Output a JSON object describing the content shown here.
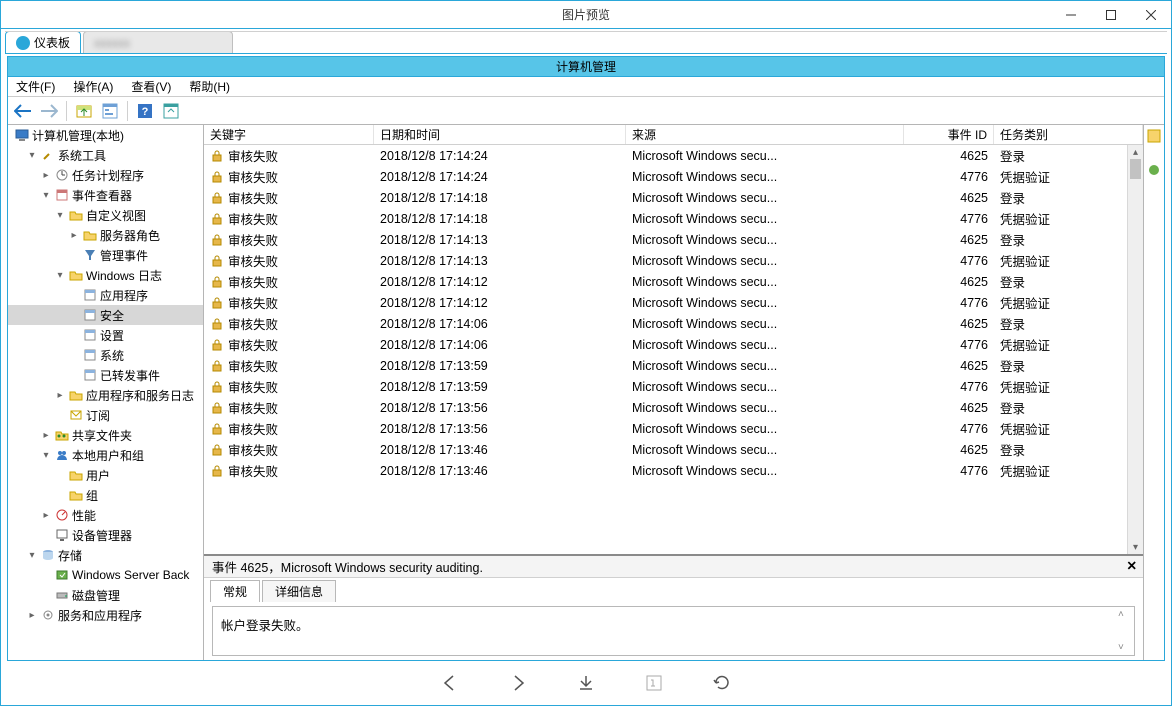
{
  "outer_window": {
    "title": "图片预览"
  },
  "tabs": {
    "dashboard_label": "仪表板"
  },
  "inner_window": {
    "title": "计算机管理"
  },
  "menu": {
    "file": "文件(F)",
    "action": "操作(A)",
    "view": "查看(V)",
    "help": "帮助(H)"
  },
  "tree": {
    "root": "计算机管理(本地)",
    "sys_tools": "系统工具",
    "task_scheduler": "任务计划程序",
    "event_viewer": "事件查看器",
    "custom_views": "自定义视图",
    "server_roles": "服务器角色",
    "admin_events": "管理事件",
    "windows_logs": "Windows 日志",
    "application": "应用程序",
    "security": "安全",
    "setup": "设置",
    "system": "系统",
    "forwarded": "已转发事件",
    "app_services_logs": "应用程序和服务日志",
    "subscriptions": "订阅",
    "shared_folders": "共享文件夹",
    "local_users_groups": "本地用户和组",
    "users": "用户",
    "groups": "组",
    "performance": "性能",
    "device_manager": "设备管理器",
    "storage": "存储",
    "wsb": "Windows Server Back",
    "disk_mgmt": "磁盘管理",
    "services_apps": "服务和应用程序"
  },
  "event_table": {
    "headers": {
      "keyword": "关键字",
      "datetime": "日期和时间",
      "source": "来源",
      "eventid": "事件 ID",
      "task": "任务类别"
    },
    "rows": [
      {
        "keyword": "审核失败",
        "datetime": "2018/12/8 17:14:24",
        "source": "Microsoft Windows secu...",
        "id": "4625",
        "task": "登录"
      },
      {
        "keyword": "审核失败",
        "datetime": "2018/12/8 17:14:24",
        "source": "Microsoft Windows secu...",
        "id": "4776",
        "task": "凭据验证"
      },
      {
        "keyword": "审核失败",
        "datetime": "2018/12/8 17:14:18",
        "source": "Microsoft Windows secu...",
        "id": "4625",
        "task": "登录"
      },
      {
        "keyword": "审核失败",
        "datetime": "2018/12/8 17:14:18",
        "source": "Microsoft Windows secu...",
        "id": "4776",
        "task": "凭据验证"
      },
      {
        "keyword": "审核失败",
        "datetime": "2018/12/8 17:14:13",
        "source": "Microsoft Windows secu...",
        "id": "4625",
        "task": "登录"
      },
      {
        "keyword": "审核失败",
        "datetime": "2018/12/8 17:14:13",
        "source": "Microsoft Windows secu...",
        "id": "4776",
        "task": "凭据验证"
      },
      {
        "keyword": "审核失败",
        "datetime": "2018/12/8 17:14:12",
        "source": "Microsoft Windows secu...",
        "id": "4625",
        "task": "登录"
      },
      {
        "keyword": "审核失败",
        "datetime": "2018/12/8 17:14:12",
        "source": "Microsoft Windows secu...",
        "id": "4776",
        "task": "凭据验证"
      },
      {
        "keyword": "审核失败",
        "datetime": "2018/12/8 17:14:06",
        "source": "Microsoft Windows secu...",
        "id": "4625",
        "task": "登录"
      },
      {
        "keyword": "审核失败",
        "datetime": "2018/12/8 17:14:06",
        "source": "Microsoft Windows secu...",
        "id": "4776",
        "task": "凭据验证"
      },
      {
        "keyword": "审核失败",
        "datetime": "2018/12/8 17:13:59",
        "source": "Microsoft Windows secu...",
        "id": "4625",
        "task": "登录"
      },
      {
        "keyword": "审核失败",
        "datetime": "2018/12/8 17:13:59",
        "source": "Microsoft Windows secu...",
        "id": "4776",
        "task": "凭据验证"
      },
      {
        "keyword": "审核失败",
        "datetime": "2018/12/8 17:13:56",
        "source": "Microsoft Windows secu...",
        "id": "4625",
        "task": "登录"
      },
      {
        "keyword": "审核失败",
        "datetime": "2018/12/8 17:13:56",
        "source": "Microsoft Windows secu...",
        "id": "4776",
        "task": "凭据验证"
      },
      {
        "keyword": "审核失败",
        "datetime": "2018/12/8 17:13:46",
        "source": "Microsoft Windows secu...",
        "id": "4625",
        "task": "登录"
      },
      {
        "keyword": "审核失败",
        "datetime": "2018/12/8 17:13:46",
        "source": "Microsoft Windows secu...",
        "id": "4776",
        "task": "凭据验证"
      }
    ]
  },
  "detail": {
    "title": "事件 4625，Microsoft Windows security auditing.",
    "tab_general": "常规",
    "tab_details": "详细信息",
    "body_text": "帐户登录失败。"
  }
}
